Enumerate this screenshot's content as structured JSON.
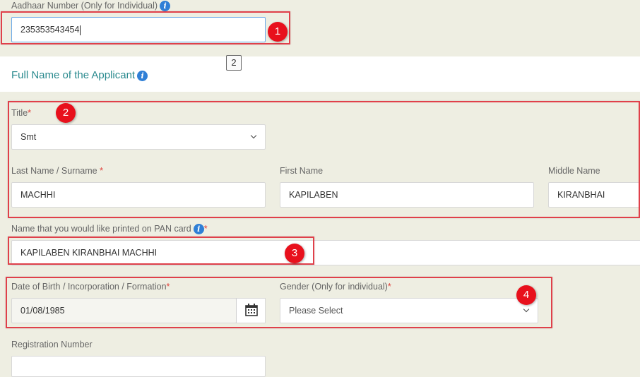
{
  "aadhaar": {
    "label": "Aadhaar Number (Only for Individual)",
    "value": "235353543454"
  },
  "full_name_section": {
    "title": "Full Name of the Applicant"
  },
  "title_field": {
    "label": "Title",
    "required_mark": "*",
    "selected": "Smt"
  },
  "last_name": {
    "label": "Last Name / Surname",
    "required_mark": "*",
    "value": "MACHHI"
  },
  "first_name": {
    "label": "First Name",
    "value": "KAPILABEN"
  },
  "middle_name": {
    "label": "Middle Name",
    "value": "KIRANBHAI"
  },
  "pan_print_name": {
    "label": "Name that you would like printed on PAN card",
    "required_mark": "*",
    "value": "KAPILABEN KIRANBHAI MACHHI"
  },
  "dob": {
    "label": "Date of Birth / Incorporation / Formation",
    "required_mark": "*",
    "value": "01/08/1985"
  },
  "gender": {
    "label": "Gender (Only for individual)",
    "required_mark": "*",
    "selected": "Please Select"
  },
  "registration": {
    "label": "Registration Number",
    "value": ""
  },
  "annotations": {
    "badge_1": "1",
    "badge_2": "2",
    "badge_3": "3",
    "badge_4": "4",
    "tag_2": "2"
  },
  "colors": {
    "page_bg": "#eeeee2",
    "section_title": "#2a8a8e",
    "highlight": "#e0404a",
    "badge": "#e8101c",
    "info_icon": "#2f7fd6"
  },
  "icons": {
    "info": "info-icon",
    "calendar": "calendar-icon",
    "dropdown": "chevron-down-icon"
  }
}
